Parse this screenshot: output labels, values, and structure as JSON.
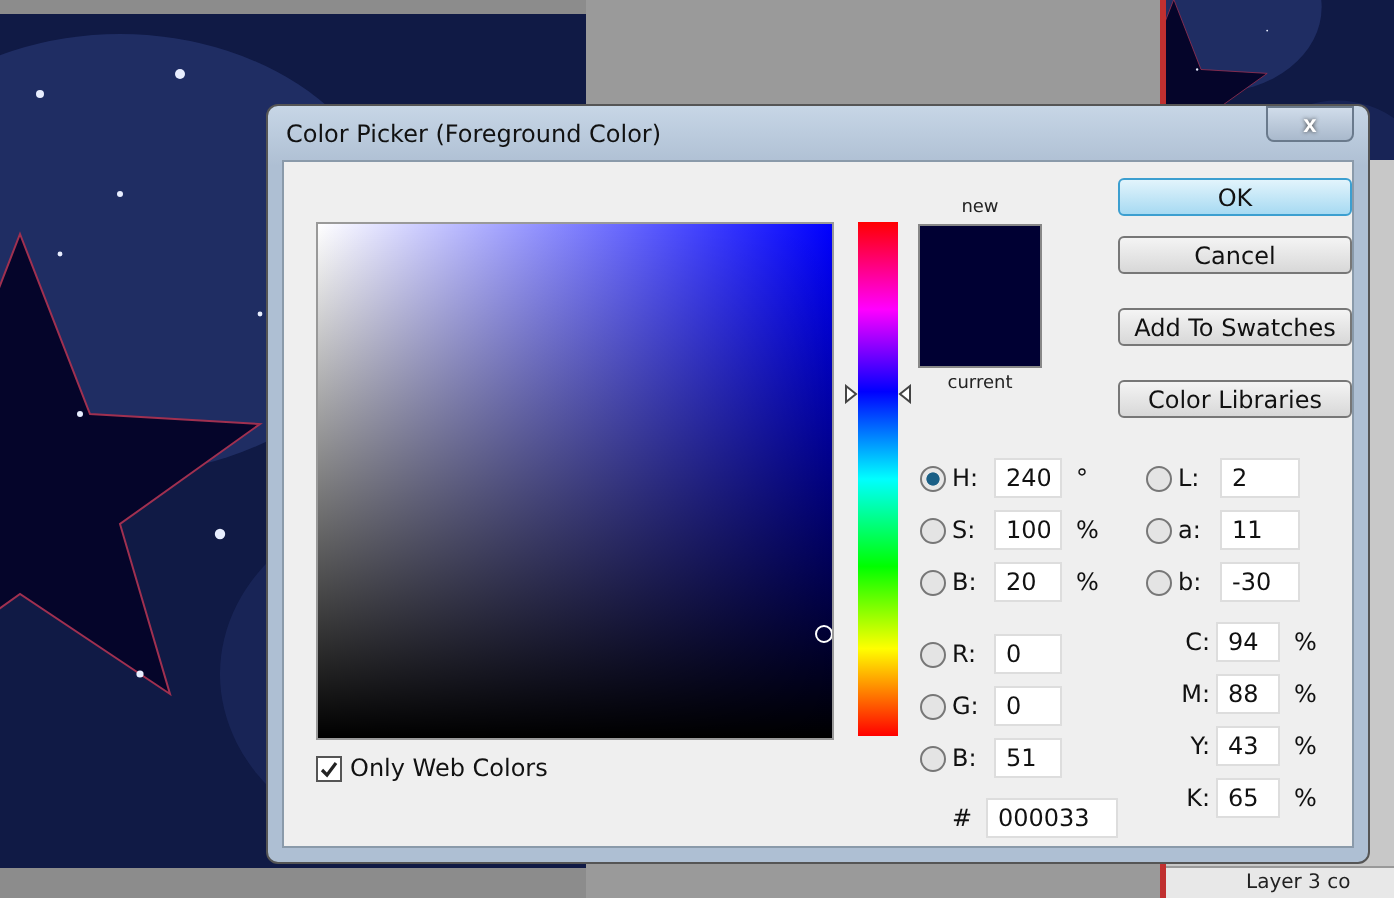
{
  "dialog": {
    "title": "Color Picker (Foreground Color)",
    "close_glyph": "x"
  },
  "only_web_colors": {
    "label": "Only Web Colors",
    "checked": true
  },
  "swatch": {
    "new_label": "new",
    "current_label": "current"
  },
  "hue_slider": {
    "level": 0.665
  },
  "buttons": [
    {
      "label": "OK",
      "default": true
    },
    {
      "label": "Cancel",
      "default": false
    },
    {
      "label": "Add To Swatches",
      "default": false
    },
    {
      "label": "Color Libraries",
      "default": false
    }
  ],
  "hsb_rgb": [
    {
      "label": "H:",
      "value": "240",
      "unit": "°",
      "selected": true
    },
    {
      "label": "S:",
      "value": "100",
      "unit": "%",
      "selected": false
    },
    {
      "label": "B:",
      "value": "20",
      "unit": "%",
      "selected": false
    },
    {
      "label": "R:",
      "value": "0",
      "selected": false
    },
    {
      "label": "G:",
      "value": "0",
      "selected": false
    },
    {
      "label": "B:",
      "value": "51",
      "selected": false
    }
  ],
  "lab": [
    {
      "label": "L:",
      "value": "2",
      "selected": false
    },
    {
      "label": "a:",
      "value": "11",
      "selected": false
    },
    {
      "label": "b:",
      "value": "-30",
      "selected": false
    }
  ],
  "cmyk": [
    {
      "label": "C:",
      "value": "94",
      "unit": "%"
    },
    {
      "label": "M:",
      "value": "88",
      "unit": "%"
    },
    {
      "label": "Y:",
      "value": "43",
      "unit": "%"
    },
    {
      "label": "K:",
      "value": "65",
      "unit": "%"
    }
  ],
  "hex": {
    "label": "#",
    "value": "000033"
  },
  "layers_panel": {
    "layer_name": "Layer 3 co"
  }
}
